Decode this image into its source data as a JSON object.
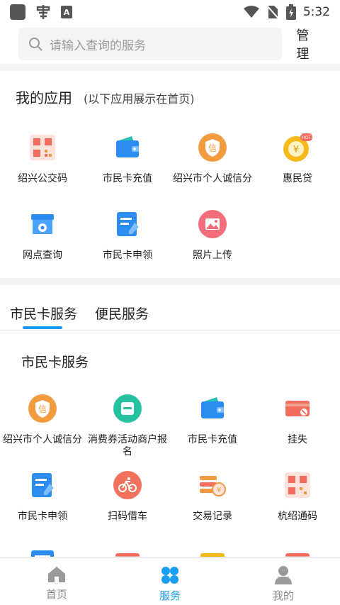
{
  "status": {
    "time": "5:32"
  },
  "search": {
    "placeholder": "请输入查询的服务",
    "manage": "管理"
  },
  "my_apps": {
    "title": "我的应用",
    "subtitle": "(以下应用展示在首页)",
    "items": [
      {
        "label": "绍兴公交码",
        "icon": "qr-code-icon"
      },
      {
        "label": "市民卡充值",
        "icon": "wallet-icon"
      },
      {
        "label": "绍兴市个人诚信分",
        "icon": "credit-shield-icon"
      },
      {
        "label": "惠民贷",
        "icon": "money-bag-icon",
        "badge": "HOT"
      },
      {
        "label": "网点查询",
        "icon": "store-location-icon"
      },
      {
        "label": "市民卡申领",
        "icon": "apply-form-icon"
      },
      {
        "label": "照片上传",
        "icon": "photo-icon"
      }
    ]
  },
  "service_tabs": [
    "市民卡服务",
    "便民服务"
  ],
  "services": {
    "title": "市民卡服务",
    "items": [
      {
        "label": "绍兴市个人诚信分",
        "icon": "credit-shield-icon"
      },
      {
        "label": "消费券活动商户报名",
        "icon": "coupon-icon"
      },
      {
        "label": "市民卡充值",
        "icon": "wallet-icon"
      },
      {
        "label": "挂失",
        "icon": "card-lost-icon"
      },
      {
        "label": "市民卡申领",
        "icon": "apply-form-icon"
      },
      {
        "label": "扫码借车",
        "icon": "bike-icon"
      },
      {
        "label": "交易记录",
        "icon": "transaction-record-icon"
      },
      {
        "label": "杭绍通码",
        "icon": "qr-code-icon"
      },
      {
        "label": "",
        "icon": "list-icon"
      },
      {
        "label": "",
        "icon": "card-icon"
      },
      {
        "label": "",
        "icon": "yellow-card-icon"
      },
      {
        "label": "",
        "icon": "card-icon"
      }
    ]
  },
  "bottom_nav": [
    {
      "label": "首页",
      "icon": "home-icon"
    },
    {
      "label": "服务",
      "icon": "services-icon"
    },
    {
      "label": "我的",
      "icon": "user-icon"
    }
  ],
  "colors": {
    "accent": "#1a9cf3",
    "orange": "#f29a3f",
    "red": "#f36d5e"
  }
}
